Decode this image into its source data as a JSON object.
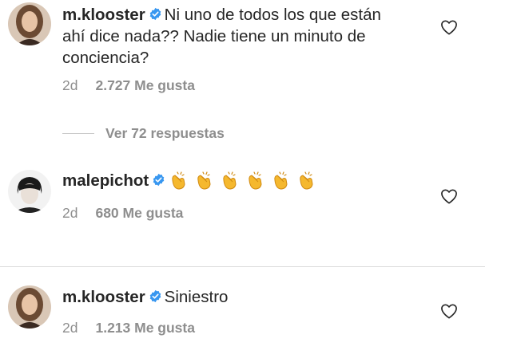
{
  "comments": [
    {
      "username": "m.klooster",
      "verified": true,
      "text": "Ni uno de todos los que están ahí dice nada?? Nadie tiene un minuto de conciencia?",
      "time": "2d",
      "likes": "2.727 Me gusta",
      "replies": "Ver 72 respuestas"
    },
    {
      "username": "malepichot",
      "verified": true,
      "text": "👏👏👏👏👏👏",
      "time": "2d",
      "likes": "680 Me gusta"
    },
    {
      "username": "m.klooster",
      "verified": true,
      "text": "Siniestro",
      "time": "2d",
      "likes": "1.213 Me gusta"
    }
  ],
  "icons": {
    "verified": "verified-badge-icon",
    "like": "heart-outline-icon",
    "clap": "clapping-hands-emoji"
  },
  "colors": {
    "text": "#262626",
    "secondary": "#8e8e8e",
    "verified": "#3897f0",
    "divider": "#dbdbdb"
  }
}
